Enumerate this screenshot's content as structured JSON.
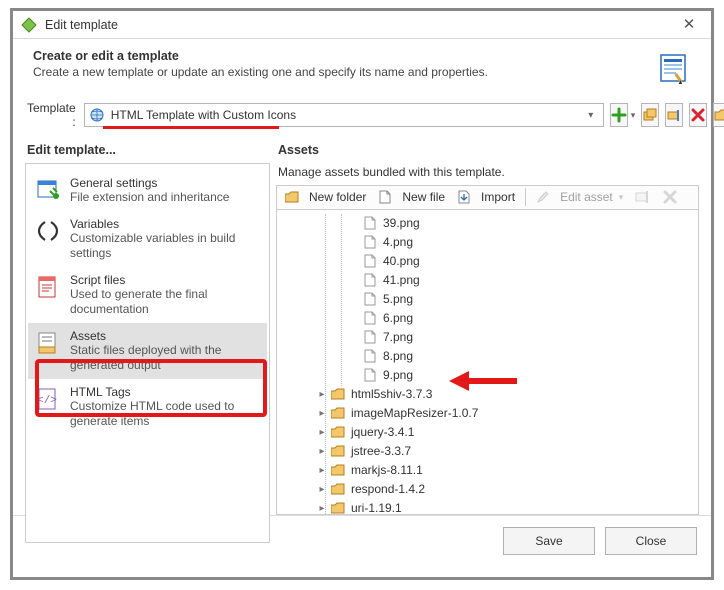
{
  "window": {
    "title": "Edit template"
  },
  "header": {
    "title": "Create or edit a template",
    "subtitle": "Create a new template or update an existing one and specify its name and properties."
  },
  "templateRow": {
    "label": "Template :",
    "selected": "HTML Template with Custom Icons"
  },
  "leftPane": {
    "title": "Edit template...",
    "items": [
      {
        "title": "General settings",
        "desc": "File extension and inheritance"
      },
      {
        "title": "Variables",
        "desc": "Customizable variables in build settings"
      },
      {
        "title": "Script files",
        "desc": "Used to generate the final documentation"
      },
      {
        "title": "Assets",
        "desc": "Static files deployed with the generated output"
      },
      {
        "title": "HTML Tags",
        "desc": "Customize HTML code used to generate items"
      }
    ],
    "selectedIndex": 3
  },
  "rightPane": {
    "title": "Assets",
    "subtitle": "Manage assets bundled with this template.",
    "toolbar": {
      "newFolder": "New folder",
      "newFile": "New file",
      "import": "Import",
      "editAsset": "Edit asset"
    },
    "files": [
      "39.png",
      "4.png",
      "40.png",
      "41.png",
      "5.png",
      "6.png",
      "7.png",
      "8.png",
      "9.png"
    ],
    "folders": [
      "html5shiv-3.7.3",
      "imageMapResizer-1.0.7",
      "jquery-3.4.1",
      "jstree-3.3.7",
      "markjs-8.11.1",
      "respond-1.4.2",
      "uri-1.19.1"
    ],
    "highlightFileIndex": 7
  },
  "footer": {
    "save": "Save",
    "close": "Close"
  }
}
